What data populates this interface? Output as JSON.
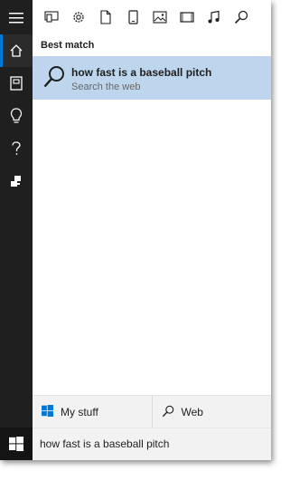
{
  "rail": {
    "items": [
      {
        "name": "menu-icon",
        "active": false
      },
      {
        "name": "home-icon",
        "active": true
      },
      {
        "name": "notebook-icon",
        "active": false
      },
      {
        "name": "lightbulb-icon",
        "active": false
      },
      {
        "name": "help-icon",
        "active": false
      },
      {
        "name": "feedback-icon",
        "active": false
      }
    ],
    "start_icon": "windows-logo-icon"
  },
  "filters": [
    {
      "name": "apps-filter-icon"
    },
    {
      "name": "settings-filter-icon"
    },
    {
      "name": "documents-filter-icon"
    },
    {
      "name": "phone-filter-icon"
    },
    {
      "name": "photos-filter-icon"
    },
    {
      "name": "videos-filter-icon"
    },
    {
      "name": "music-filter-icon"
    },
    {
      "name": "web-search-filter-icon"
    }
  ],
  "results": {
    "section_label": "Best match",
    "best_match": {
      "title": "how fast is a baseball pitch",
      "subtitle": "Search the web",
      "icon": "search-icon"
    }
  },
  "scopes": {
    "my_stuff": "My stuff",
    "web": "Web"
  },
  "search": {
    "value": "how fast is a baseball pitch"
  },
  "colors": {
    "accent": "#0078d7",
    "rail_background": "#1f1f1f",
    "selection": "#bdd6ee"
  }
}
